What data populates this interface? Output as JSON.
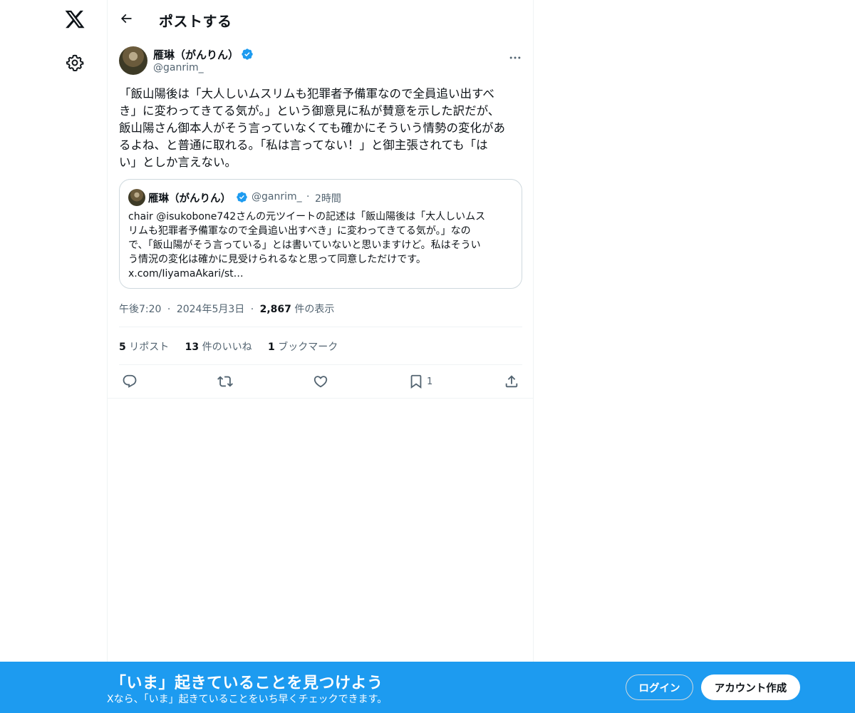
{
  "nav": {
    "logo_icon": "x-logo-icon",
    "settings_icon": "gear-icon"
  },
  "header": {
    "title": "ポストする",
    "back_icon": "arrow-left-icon"
  },
  "post": {
    "author_name": "雁琳（がんりん）",
    "author_handle": "@ganrim_",
    "verified": true,
    "text": "「飯山陽後は「大人しいムスリムも犯罪者予備軍なので全員追い出すべ\nき」に変わってきてる気が。」という御意見に私が賛意を示した訳だが、\n飯山陽さん御本人がそう言っていなくても確かにそういう情勢の変化があ\nるよね、と普通に取れる。「私は言ってない！」と御主張されても「は\nい」としか言えない。",
    "quote": {
      "author_name": "雁琳（がんりん）",
      "author_handle": "@ganrim_",
      "separator": "·",
      "time": "2時間",
      "text": "chair @isukobone742さんの元ツイートの記述は「飯山陽後は「大人しいムス\nリムも犯罪者予備軍なので全員追い出すべき」に変わってきてる気が。」なの\nで、「飯山陽がそう言っている」とは書いていないと思いますけど。私はそうい\nう情況の変化は確かに見受けられるなと思って同意しただけです。\nx.com/IiyamaAkari/st…"
    },
    "meta": {
      "time": "午後7:20",
      "dot1": "·",
      "date": "2024年5月3日",
      "dot2": "·",
      "views_count": "2,867",
      "views_label": "件の表示"
    },
    "stats": {
      "reposts_count": "5",
      "reposts_label": "リポスト",
      "likes_count": "13",
      "likes_label": "件のいいね",
      "bookmarks_count": "1",
      "bookmarks_label": "ブックマーク"
    },
    "actions": {
      "reply_icon": "reply-icon",
      "repost_icon": "repost-icon",
      "like_icon": "heart-icon",
      "bookmark_icon": "bookmark-icon",
      "bookmark_count": "1",
      "share_icon": "share-icon"
    }
  },
  "banner": {
    "title": "「いま」起きていることを見つけよう",
    "subtitle": "Xなら、「いま」起きていることをいち早くチェックできます。",
    "login_label": "ログイン",
    "signup_label": "アカウント作成"
  },
  "colors": {
    "accent": "#1d9bf0",
    "text": "#0f1419",
    "secondary_text": "#536471",
    "border": "#eff3f4"
  }
}
